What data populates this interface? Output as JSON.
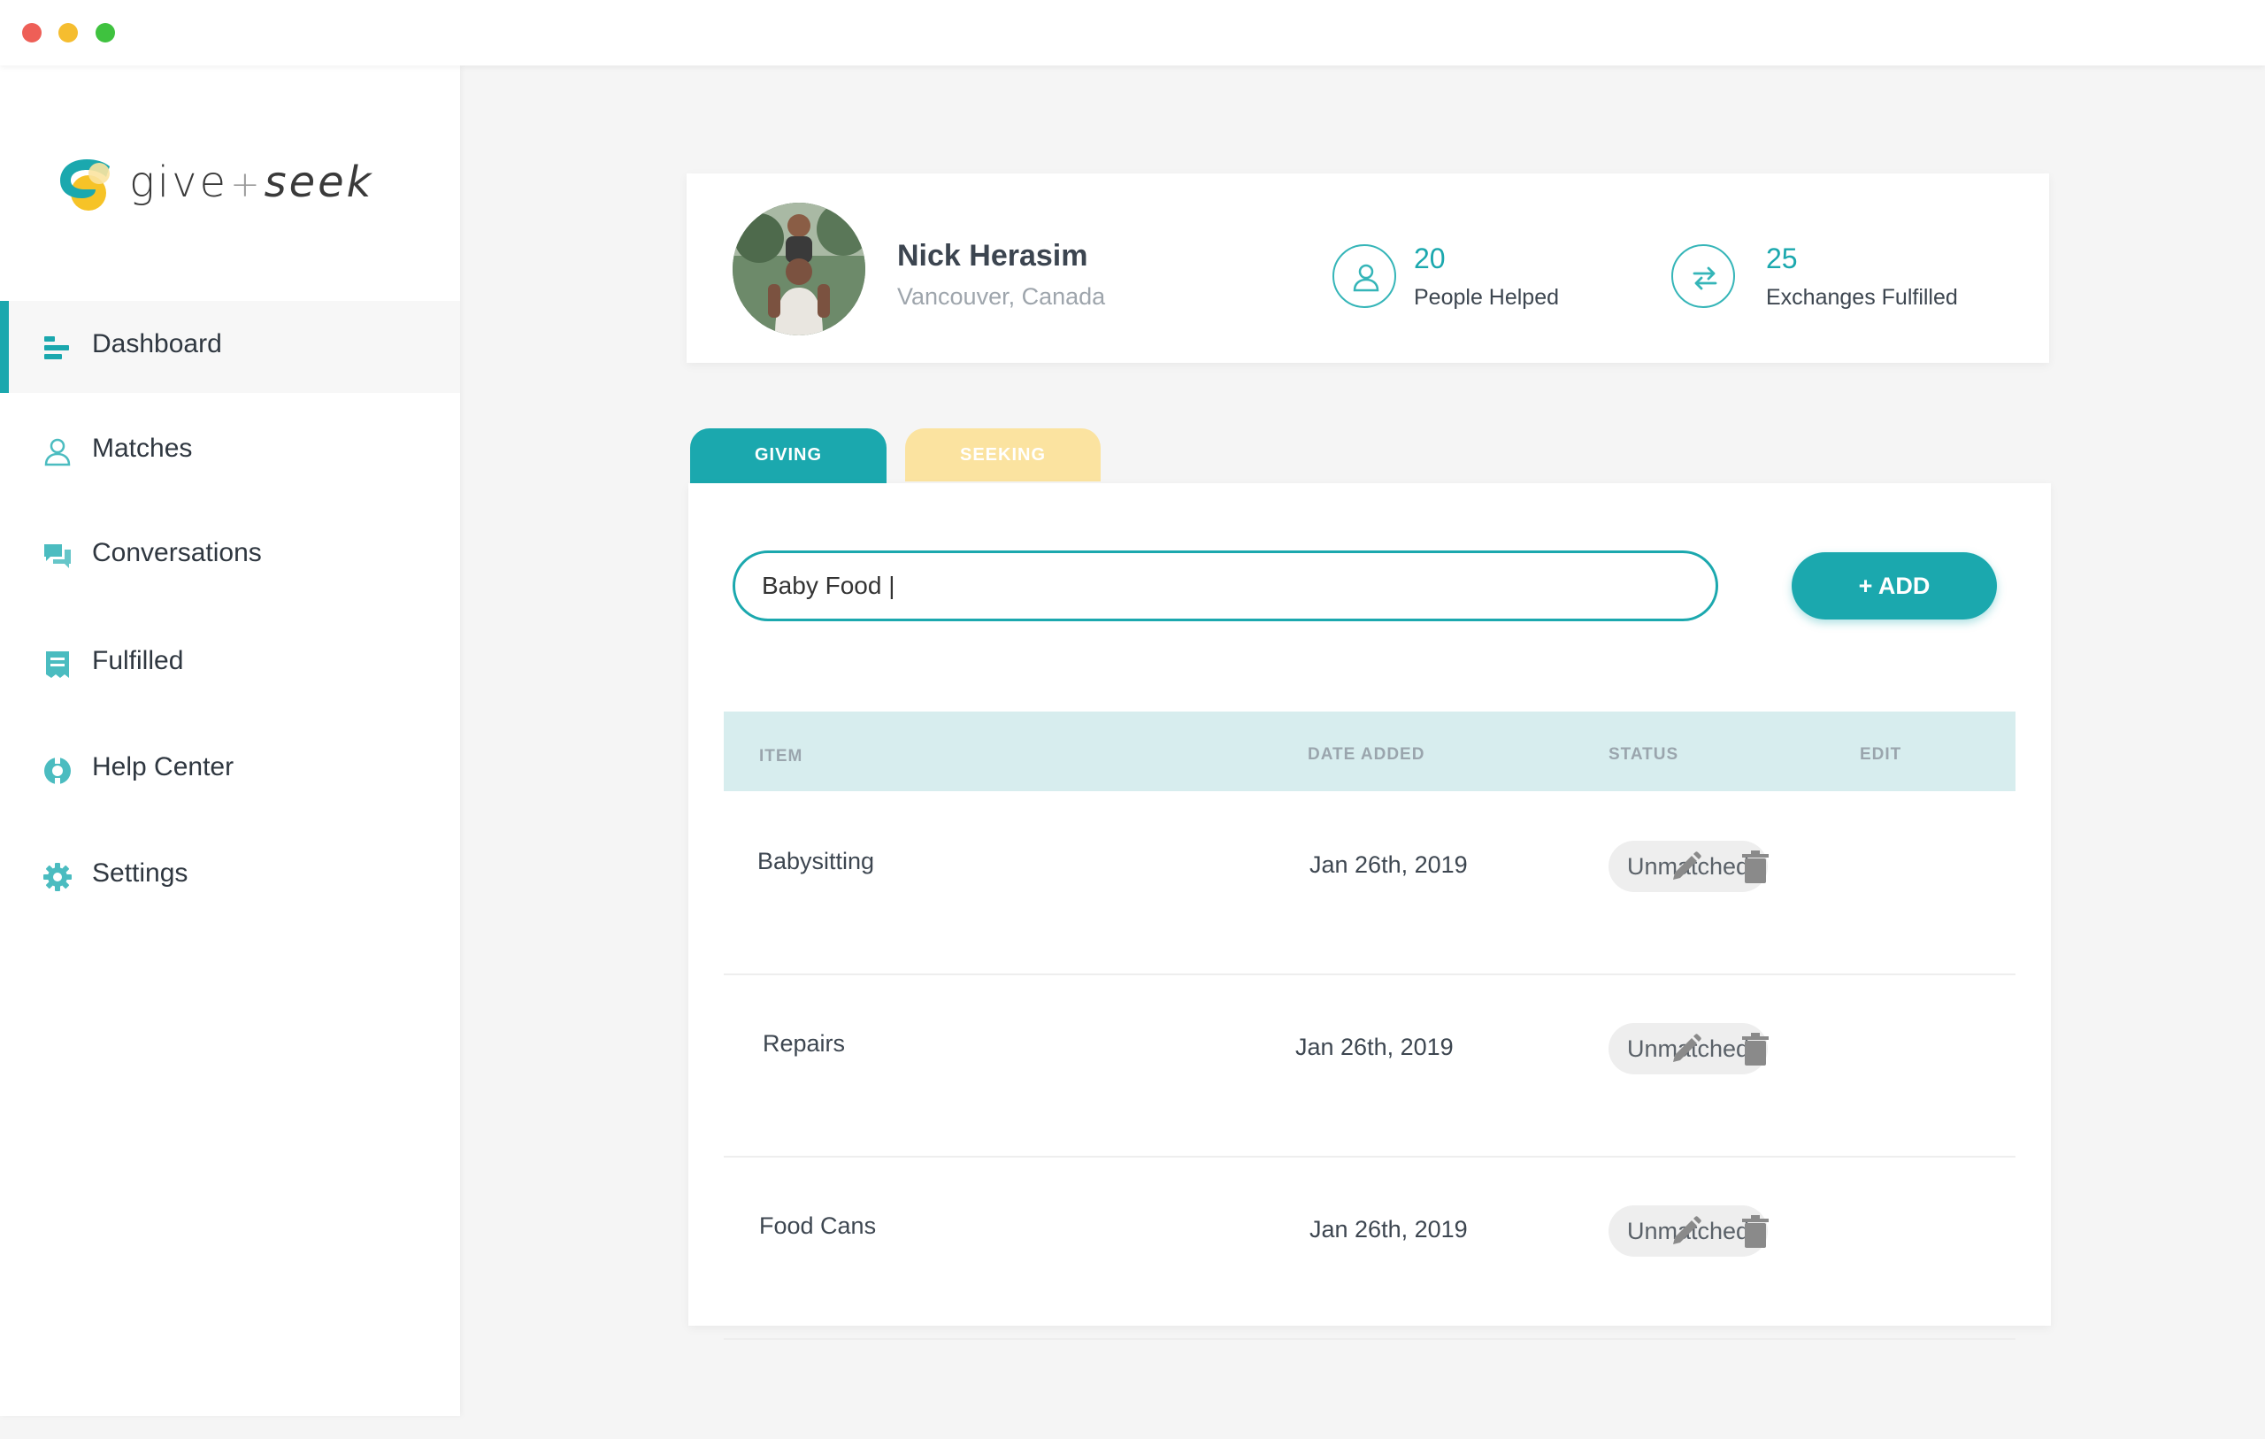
{
  "app": {
    "logo_give": "give",
    "logo_plus": "+",
    "logo_seek": "seek"
  },
  "sidebar": {
    "items": [
      {
        "label": "Dashboard",
        "icon": "dashboard-icon",
        "active": true
      },
      {
        "label": "Matches",
        "icon": "user-icon"
      },
      {
        "label": "Conversations",
        "icon": "chat-icon"
      },
      {
        "label": "Fulfilled",
        "icon": "receipt-icon"
      },
      {
        "label": "Help Center",
        "icon": "lifebuoy-icon"
      },
      {
        "label": "Settings",
        "icon": "gear-icon"
      }
    ]
  },
  "profile": {
    "name": "Nick Herasim",
    "location": "Vancouver, Canada",
    "stats": [
      {
        "value": "20",
        "label": "People Helped",
        "icon": "person-icon"
      },
      {
        "value": "25",
        "label": "Exchanges Fulfilled",
        "icon": "exchange-icon"
      }
    ]
  },
  "tabs": {
    "giving": "GIVING",
    "seeking": "SEEKING"
  },
  "search": {
    "value": "Baby Food |"
  },
  "add_button": "+ ADD",
  "table": {
    "headers": {
      "item": "ITEM",
      "date": "DATE ADDED",
      "status": "STATUS",
      "edit": "EDIT"
    },
    "rows": [
      {
        "item": "Babysitting",
        "date": "Jan 26th, 2019",
        "status": "Unmatched"
      },
      {
        "item": "Repairs",
        "date": "Jan 26th, 2019",
        "status": "Unmatched"
      },
      {
        "item": "Food Cans",
        "date": "Jan 26th, 2019",
        "status": "Unmatched"
      }
    ]
  },
  "colors": {
    "accent": "#1ba8ae",
    "seeking_tab": "#fbe3a0",
    "table_header": "#d7edee"
  }
}
